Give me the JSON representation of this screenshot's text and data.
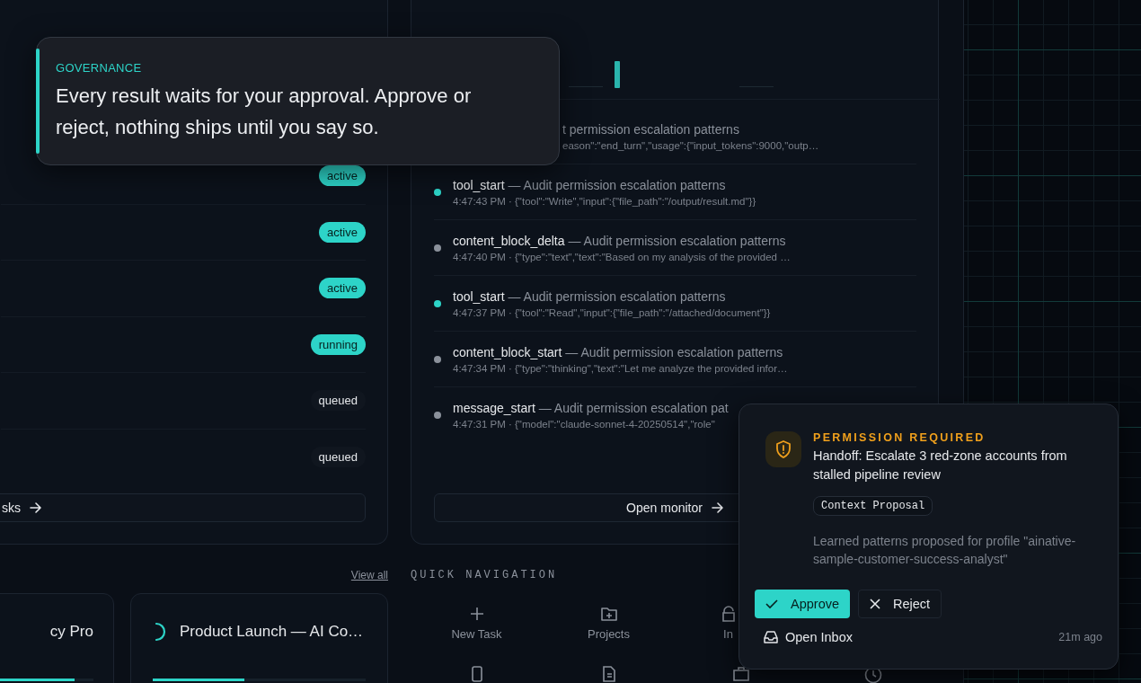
{
  "tasks_panel": {
    "rows": [
      {
        "status": "active",
        "highlighted": true
      },
      {
        "status": "active",
        "highlighted": true
      },
      {
        "status": "active",
        "highlighted": true
      },
      {
        "status": "running",
        "highlighted": true
      },
      {
        "status": "queued",
        "highlighted": false
      },
      {
        "status": "queued",
        "highlighted": false
      }
    ],
    "footer_button": "sks"
  },
  "monitor_panel": {
    "events": [
      {
        "kind": "clipped",
        "title": "t permission escalation patterns",
        "detail": "eason\":\"end_turn\",\"usage\":{\"input_tokens\":9000,\"outp…"
      },
      {
        "kind": "full",
        "color": "#2dd4c8",
        "name": "tool_start",
        "title": "— Audit permission escalation patterns",
        "detail": "4:47:43 PM · {\"tool\":\"Write\",\"input\":{\"file_path\":\"/output/result.md\"}}"
      },
      {
        "kind": "full",
        "color": "#8b919b",
        "name": "content_block_delta",
        "title": "— Audit permission escalation patterns",
        "detail": "4:47:40 PM · {\"type\":\"text\",\"text\":\"Based on my analysis of the provided …"
      },
      {
        "kind": "full",
        "color": "#2dd4c8",
        "name": "tool_start",
        "title": "— Audit permission escalation patterns",
        "detail": "4:47:37 PM · {\"tool\":\"Read\",\"input\":{\"file_path\":\"/attached/document\"}}"
      },
      {
        "kind": "full",
        "color": "#8b919b",
        "name": "content_block_start",
        "title": "— Audit permission escalation patterns",
        "detail": "4:47:34 PM · {\"type\":\"thinking\",\"text\":\"Let me analyze the provided infor…"
      },
      {
        "kind": "full",
        "color": "#8b919b",
        "name": "message_start",
        "title": "— Audit permission escalation pat",
        "detail": "4:47:31 PM · {\"model\":\"claude-sonnet-4-20250514\",\"role\""
      }
    ],
    "footer_button": "Open monitor"
  },
  "projects": {
    "view_all": "View all",
    "cards": [
      {
        "title": "cy Pro",
        "running": false,
        "level": 0.8
      },
      {
        "title": "Product Launch — AI Co…",
        "running": true,
        "level": 0.43
      }
    ]
  },
  "quick_navigation": {
    "title": "QUICK NAVIGATION",
    "items": [
      {
        "label": "New Task"
      },
      {
        "label": "Projects"
      },
      {
        "label": "In"
      }
    ]
  },
  "governance_callout": {
    "label": "GOVERNANCE",
    "text": "Every result waits for your approval. Approve or reject, nothing ships until you say so."
  },
  "permission_popup": {
    "label": "PERMISSION REQUIRED",
    "title": "Handoff: Escalate 3 red-zone accounts from stalled pipeline review",
    "tag": "Context Proposal",
    "description": "Learned patterns proposed for profile \"ainative-sample-customer-success-analyst\"",
    "approve": "Approve",
    "reject": "Reject",
    "open_inbox": "Open Inbox",
    "time": "21m ago"
  }
}
